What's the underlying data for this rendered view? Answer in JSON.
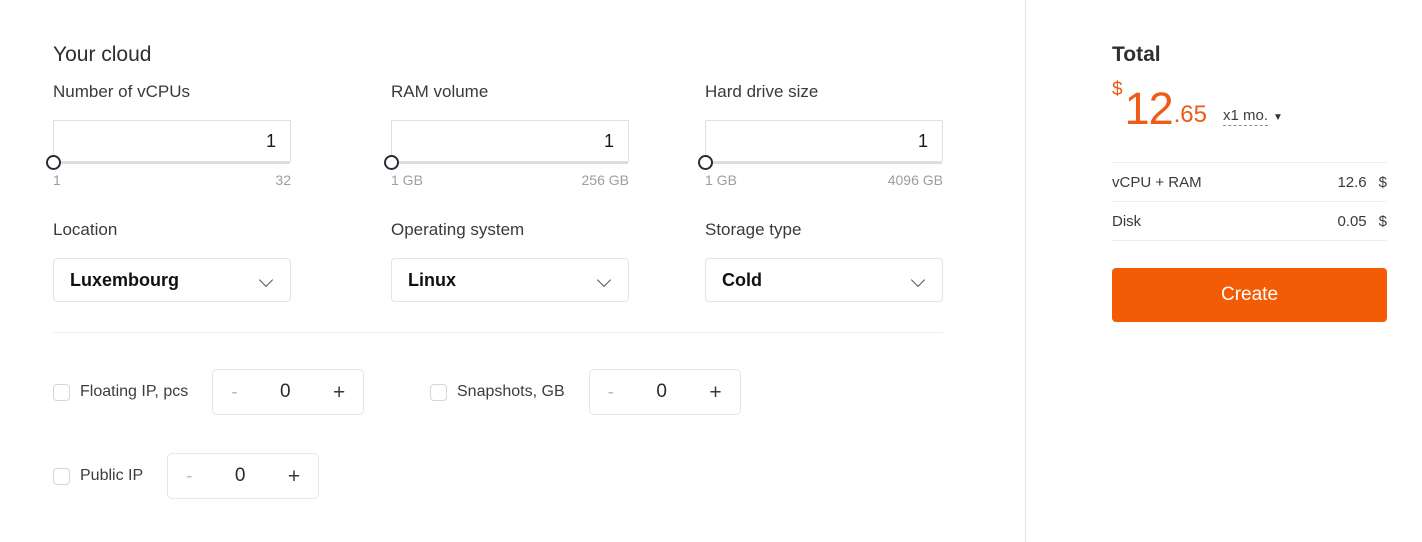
{
  "config": {
    "heading": "Your cloud",
    "sliders": [
      {
        "label": "Number of vCPUs",
        "value": "1",
        "min_label": "1",
        "max_label": "32"
      },
      {
        "label": "RAM volume",
        "value": "1",
        "min_label": "1 GB",
        "max_label": "256 GB"
      },
      {
        "label": "Hard drive size",
        "value": "1",
        "min_label": "1 GB",
        "max_label": "4096 GB"
      }
    ],
    "selects": [
      {
        "label": "Location",
        "value": "Luxembourg",
        "icon": "chevron-down-icon"
      },
      {
        "label": "Operating system",
        "value": "Linux",
        "icon": "chevron-down-icon"
      },
      {
        "label": "Storage type",
        "value": "Cold",
        "icon": "chevron-down-icon"
      }
    ],
    "addons": [
      {
        "label": "Floating IP, pcs",
        "value": "0",
        "minus": "-",
        "plus": "+",
        "checked": false
      },
      {
        "label": "Snapshots, GB",
        "value": "0",
        "minus": "-",
        "plus": "+",
        "checked": false
      },
      {
        "label": "Public IP",
        "value": "0",
        "minus": "-",
        "plus": "+",
        "checked": false
      }
    ]
  },
  "summary": {
    "title": "Total",
    "currency_symbol": "$",
    "amount_integer": "12",
    "amount_fraction": ".65",
    "period_label": "x1 mo.",
    "period_caret": "▼",
    "breakdown": [
      {
        "label": "vCPU + RAM",
        "amount": "12.6",
        "currency": "$"
      },
      {
        "label": "Disk",
        "amount": "0.05",
        "currency": "$"
      }
    ],
    "create_label": "Create"
  },
  "colors": {
    "accent": "#f45b05",
    "price": "#ef5a16",
    "border": "#e3e3e3",
    "text": "#2b2b2b",
    "muted": "#9e9e9e"
  }
}
